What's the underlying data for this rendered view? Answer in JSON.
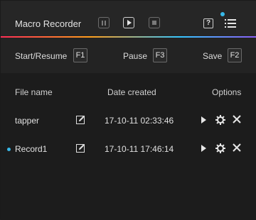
{
  "app": {
    "title": "Macro Recorder"
  },
  "titlebar": {
    "controls": [
      "pause-button",
      "play-button",
      "stop-button"
    ],
    "help_label": "?"
  },
  "hotkeys": [
    {
      "label": "Start/Resume",
      "key": "F1"
    },
    {
      "label": "Pause",
      "key": "F3"
    },
    {
      "label": "Save",
      "key": "F2"
    }
  ],
  "table": {
    "headers": {
      "name": "File name",
      "date": "Date created",
      "options": "Options"
    },
    "rows": [
      {
        "name": "tapper",
        "date": "17-10-11 02:33:46",
        "active": false
      },
      {
        "name": "Record1",
        "date": "17-10-11 17:46:14",
        "active": true
      }
    ]
  },
  "colors": {
    "accent": "#37b8e8",
    "background": "#222222"
  }
}
